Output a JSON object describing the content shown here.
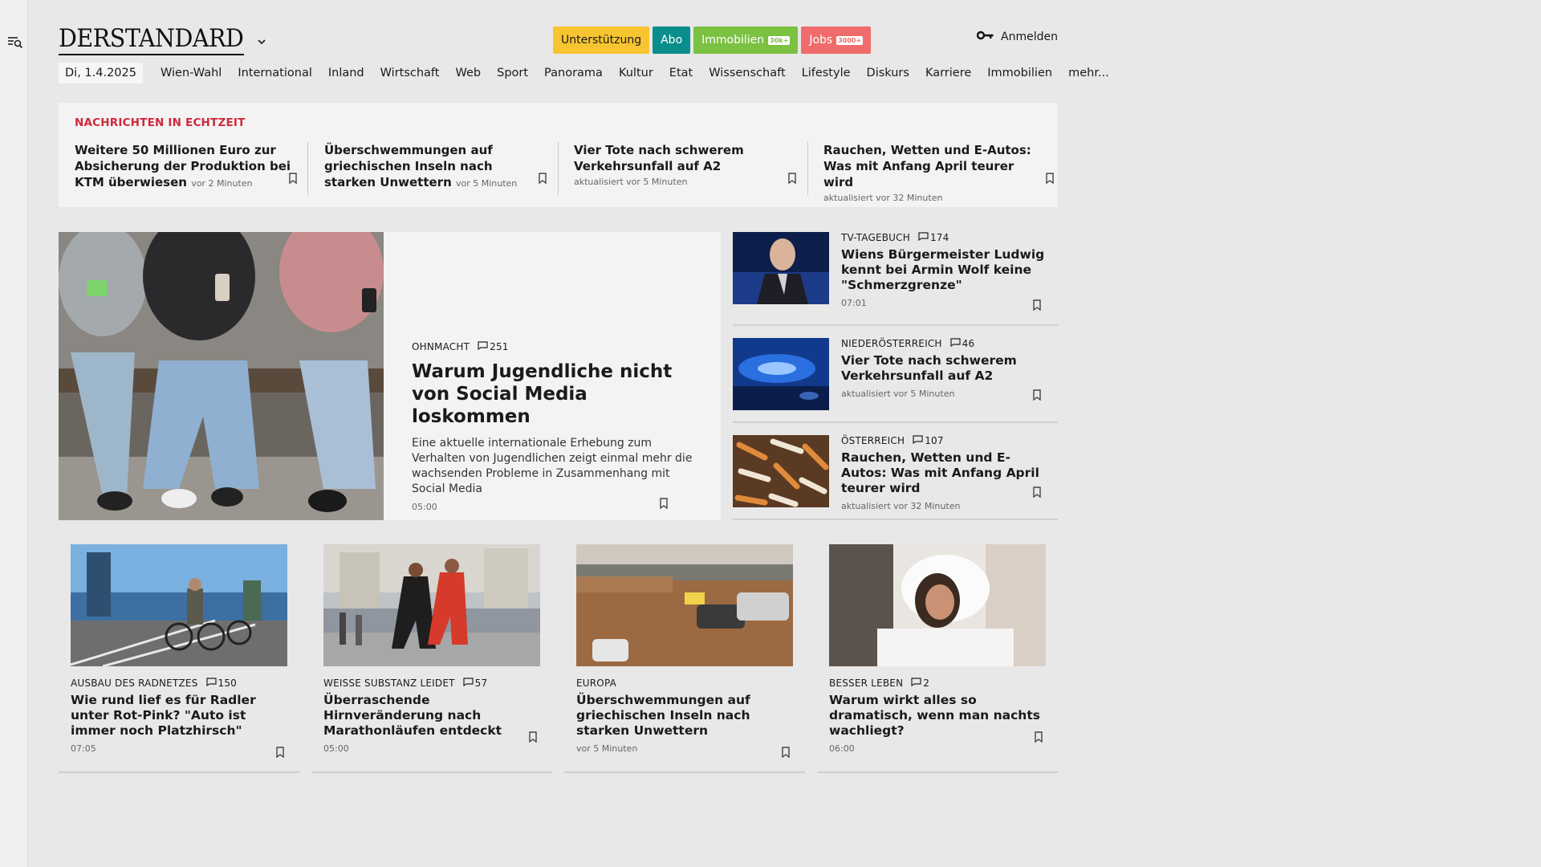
{
  "header": {
    "logo": "DERSTANDARD",
    "pills": [
      {
        "label": "Unterstützung",
        "badge": "",
        "bg": "#f7c531",
        "fg": "#1a1a1a"
      },
      {
        "label": "Abo",
        "badge": "",
        "bg": "#0a8e8c",
        "fg": "#ffffff"
      },
      {
        "label": "Immobilien",
        "badge": "30k+",
        "bg": "#7bc142",
        "fg": "#ffffff"
      },
      {
        "label": "Jobs",
        "badge": "3000+",
        "bg": "#f06c6c",
        "fg": "#ffffff"
      }
    ],
    "login": "Anmelden"
  },
  "nav": {
    "date": "Di, 1.4.2025",
    "items": [
      "Wien-Wahl",
      "International",
      "Inland",
      "Wirtschaft",
      "Web",
      "Sport",
      "Panorama",
      "Kultur",
      "Etat",
      "Wissenschaft",
      "Lifestyle",
      "Diskurs",
      "Karriere",
      "Immobilien",
      "mehr..."
    ]
  },
  "ticker": {
    "title": "NACHRICHTEN IN ECHTZEIT",
    "items": [
      {
        "headline": "Weitere 50 Millionen Euro zur Absicherung der Produktion bei KTM überwiesen",
        "time": "vor 2 Minuten"
      },
      {
        "headline": "Überschwemmungen auf griechischen Inseln nach starken Unwettern",
        "time": "vor 5 Minuten"
      },
      {
        "headline": "Vier Tote nach schwerem Verkehrsunfall auf A2",
        "time": "aktualisiert vor 5 Minuten"
      },
      {
        "headline": "Rauchen, Wetten und E-Autos: Was mit Anfang April teurer wird",
        "time": "aktualisiert vor 32 Minuten"
      }
    ]
  },
  "lead": {
    "kicker": "OHNMACHT",
    "comments": "251",
    "title": "Warum Jugendliche nicht von Social Media loskommen",
    "teaser": "Eine aktuelle internationale Erhebung zum Verhalten von Jugendlichen zeigt einmal mehr die wachsenden Probleme in Zusammenhang mit Social Media",
    "time": "05:00"
  },
  "side": [
    {
      "kicker": "TV-TAGEBUCH",
      "comments": "174",
      "title": "Wiens Bürgermeister Ludwig kennt bei Armin Wolf keine \"Schmerzgrenze\"",
      "time": "07:01"
    },
    {
      "kicker": "NIEDERÖSTERREICH",
      "comments": "46",
      "title": "Vier Tote nach schwerem Verkehrsunfall auf A2",
      "time": "aktualisiert vor 5 Minuten"
    },
    {
      "kicker": "ÖSTERREICH",
      "comments": "107",
      "title": "Rauchen, Wetten und E-Autos: Was mit Anfang April teurer wird",
      "time": "aktualisiert vor 32 Minuten"
    }
  ],
  "cards": [
    {
      "kicker": "AUSBAU DES RADNETZES",
      "comments": "150",
      "title": "Wie rund lief es für Radler unter Rot-Pink? \"Auto ist immer noch Platzhirsch\"",
      "time": "07:05"
    },
    {
      "kicker": "WEISSE SUBSTANZ LEIDET",
      "comments": "57",
      "title": "Überraschende Hirnveränderung nach Marathonläufen entdeckt",
      "time": "05:00"
    },
    {
      "kicker": "EUROPA",
      "comments": "",
      "title": "Überschwemmungen auf griechischen Inseln nach starken Unwettern",
      "time": "vor 5 Minuten"
    },
    {
      "kicker": "BESSER LEBEN",
      "comments": "2",
      "title": "Warum wirkt alles so dramatisch, wenn man nachts wachliegt?",
      "time": "06:00"
    }
  ]
}
